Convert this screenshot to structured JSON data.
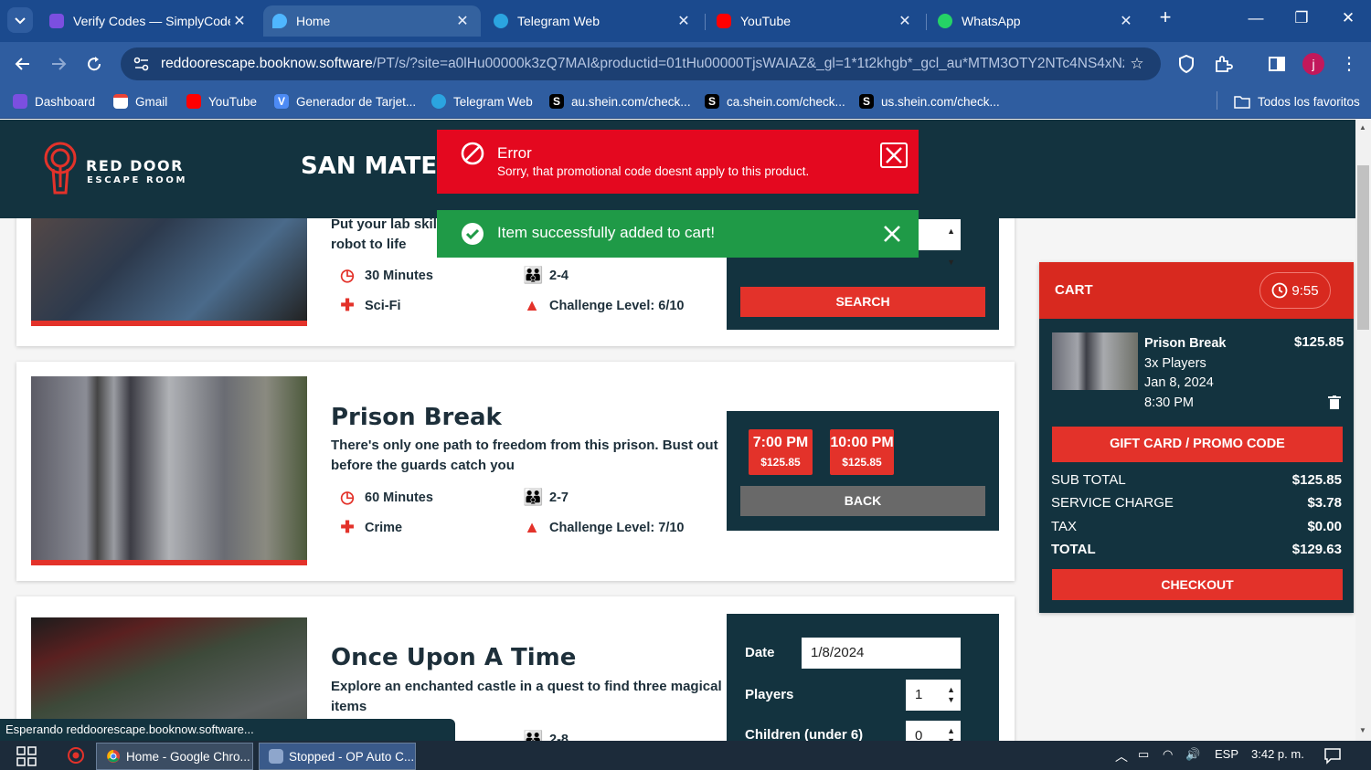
{
  "browser": {
    "tabs": [
      {
        "title": "Verify Codes — SimplyCodes",
        "icon": "simplycodes-icon",
        "close": "✕"
      },
      {
        "title": "Home",
        "icon": "booknow-icon",
        "close": "✕",
        "active": true
      },
      {
        "title": "Telegram Web",
        "icon": "telegram-icon",
        "close": "✕"
      },
      {
        "title": "YouTube",
        "icon": "youtube-icon",
        "close": "✕"
      },
      {
        "title": "WhatsApp",
        "icon": "whatsapp-icon",
        "close": "✕"
      }
    ],
    "new_tab": "+",
    "window_controls": {
      "minimize": "—",
      "restore": "❐",
      "close": "✕"
    },
    "address": {
      "domain": "reddoorescape.booknow.software",
      "path": "/PT/s/?site=a0lHu00000k3zQ7MAI&productid=01tHu00000TjsWAIAZ&_gl=1*1t2khgb*_gcl_au*MTM3OTY2NTc4NS4xNz..."
    },
    "bookmarks": [
      {
        "label": "Dashboard",
        "icon": "simplycodes-icon"
      },
      {
        "label": "Gmail",
        "icon": "gmail-icon"
      },
      {
        "label": "YouTube",
        "icon": "youtube-icon"
      },
      {
        "label": "Generador de Tarjet...",
        "icon": "v-icon"
      },
      {
        "label": "Telegram Web",
        "icon": "telegram-icon"
      },
      {
        "label": "au.shein.com/check...",
        "icon": "shein-icon"
      },
      {
        "label": "ca.shein.com/check...",
        "icon": "shein-icon"
      },
      {
        "label": "us.shein.com/check...",
        "icon": "shein-icon"
      }
    ],
    "all_bookmarks": "Todos los favoritos",
    "profile_initial": "j",
    "status_text": "Esperando reddoorescape.booknow.software..."
  },
  "site": {
    "logo": {
      "line1": "RED DOOR",
      "line2": "ESCAPE ROOM"
    },
    "location": "SAN MATEO"
  },
  "toasts": {
    "error": {
      "title": "Error",
      "message": "Sorry, that promotional code doesnt apply to this product."
    },
    "success": {
      "message": "Item successfully added to cart!"
    }
  },
  "rooms": [
    {
      "title": "",
      "desc": "Put your lab skills to the test to bring the robot to life",
      "desc_visible_1": "Put your lab skills",
      "desc_visible_2": "robot to life",
      "duration": "30 Minutes",
      "players": "2-4",
      "genre": "Sci-Fi",
      "challenge": "Challenge Level: 6/10",
      "button": "SEARCH"
    },
    {
      "title": "Prison Break",
      "desc_1": "There's only one path to freedom from this prison. Bust out",
      "desc_2": "before the guards catch you",
      "duration": "60 Minutes",
      "players": "2-7",
      "genre": "Crime",
      "challenge": "Challenge Level: 7/10",
      "slots": [
        {
          "time": "7:00 PM",
          "price": "$125.85"
        },
        {
          "time": "10:00 PM",
          "price": "$125.85"
        }
      ],
      "button": "BACK"
    },
    {
      "title": "Once Upon A Time",
      "desc_1": "Explore an enchanted castle in a quest to find three magical",
      "desc_2": "items",
      "players": "2-8",
      "form": {
        "date_label": "Date",
        "date_value": "1/8/2024",
        "players_label": "Players",
        "players_value": "1",
        "children_label": "Children (under 6)",
        "children_value": "0"
      }
    }
  ],
  "cart": {
    "title": "CART",
    "timer": "9:55",
    "item": {
      "name": "Prison Break",
      "players": "3x Players",
      "date": "Jan 8, 2024",
      "time": "8:30 PM",
      "price": "$125.85"
    },
    "promo_button": "GIFT CARD / PROMO CODE",
    "rows": [
      {
        "label": "SUB TOTAL",
        "value": "$125.85"
      },
      {
        "label": "SERVICE CHARGE",
        "value": "$3.78"
      },
      {
        "label": "TAX",
        "value": "$0.00"
      },
      {
        "label": "TOTAL",
        "value": "$129.63"
      }
    ],
    "checkout": "CHECKOUT"
  },
  "taskbar": {
    "apps": [
      {
        "label": "Home - Google Chro..."
      },
      {
        "label": "Stopped - OP Auto C..."
      }
    ],
    "lang": "ESP",
    "clock": "3:42 p. m."
  },
  "colors": {
    "brand_red": "#e3322a",
    "brand_navy": "#13333f",
    "error": "#e4081f",
    "success": "#1f9a47"
  }
}
